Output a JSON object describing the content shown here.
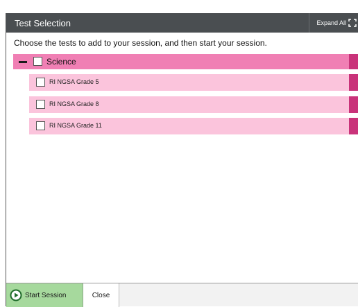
{
  "dialog": {
    "title": "Test Selection",
    "expand_all_label": "Expand All",
    "expand_icon": "expand-arrows-icon",
    "instructions": "Choose the tests to add to your session, and then start your session."
  },
  "group": {
    "label": "Science",
    "expanded": true,
    "checked": false,
    "tests": [
      {
        "label": "RI NGSA Grade 5",
        "checked": false
      },
      {
        "label": "RI NGSA Grade 8",
        "checked": false
      },
      {
        "label": "RI NGSA Grade 11",
        "checked": false
      }
    ]
  },
  "footer": {
    "start_label": "Start Session",
    "close_label": "Close"
  },
  "colors": {
    "titlebar": "#4a4e51",
    "group_row": "#f07fb4",
    "test_row": "#fbc4dc",
    "row_endcap": "#c9337a",
    "start_button": "#a6d99d"
  }
}
